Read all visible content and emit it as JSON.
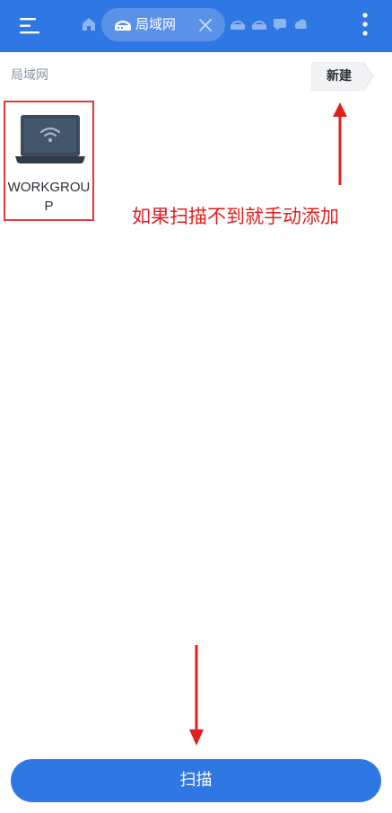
{
  "topbar": {
    "tab_label": "局域网",
    "icons": {
      "menu": "menu-icon",
      "home": "home-icon",
      "tab": "network-icon",
      "close": "close-icon",
      "more": "more-vertical-icon"
    }
  },
  "breadcrumb": {
    "label": "局域网"
  },
  "toolbar": {
    "new_label": "新建"
  },
  "devices": [
    {
      "name": "WORKGROUP",
      "icon": "laptop-wifi-icon"
    }
  ],
  "annotation": {
    "text": "如果扫描不到就手动添加"
  },
  "footer": {
    "scan_label": "扫描"
  },
  "colors": {
    "primary": "#2f78e4",
    "annotation_red": "#e02020",
    "highlight_border": "#e03a3a"
  }
}
